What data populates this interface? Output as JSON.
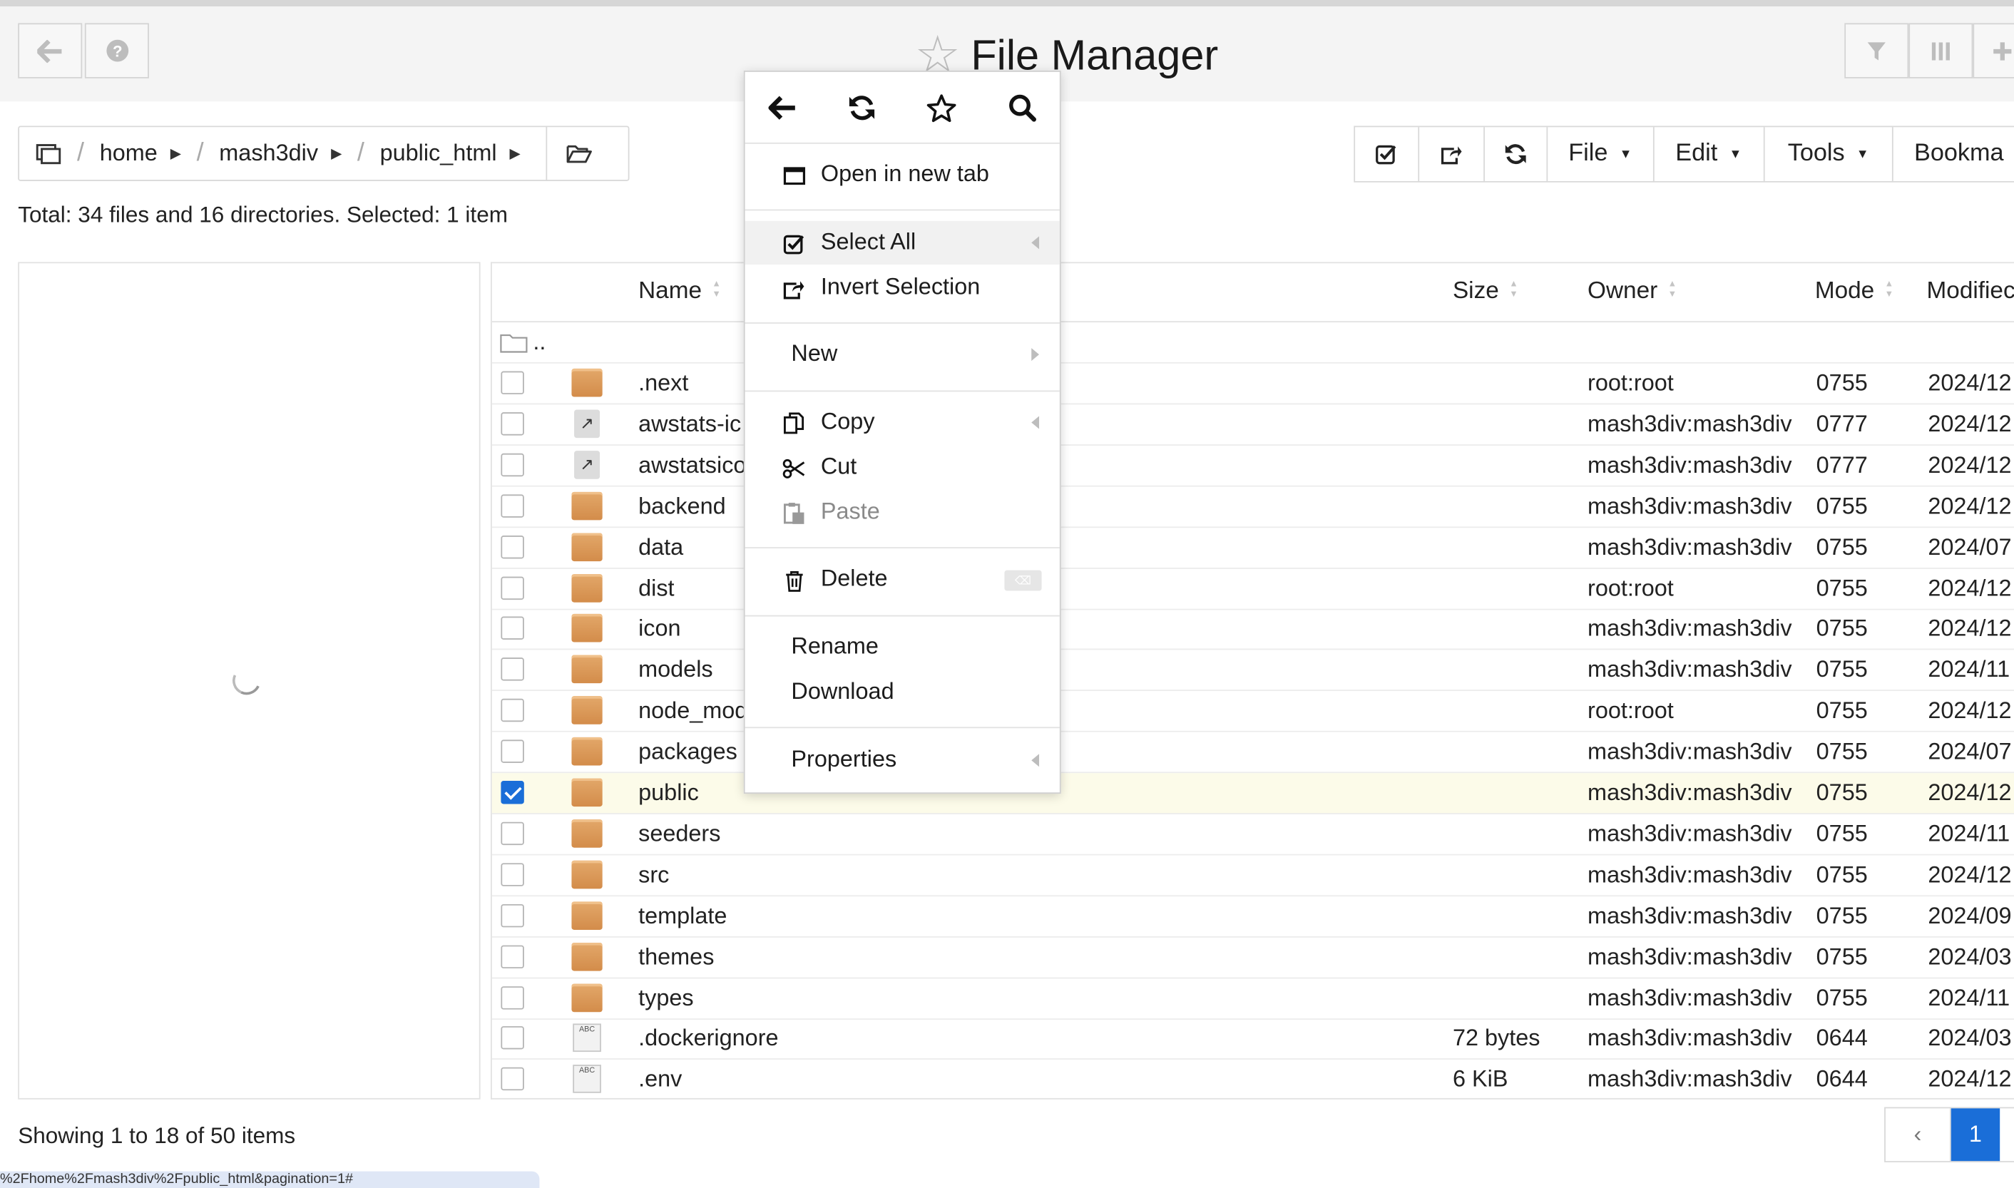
{
  "app": {
    "title": "File Manager",
    "colors": {
      "accent": "#1a6ed8",
      "folder": "#d99a5a",
      "selected_row": "#fcfbe9"
    }
  },
  "header": {
    "left_buttons": [
      {
        "icon": "arrow-left-icon"
      },
      {
        "icon": "question-circle-icon"
      }
    ],
    "right_buttons": [
      {
        "icon": "filter-icon"
      },
      {
        "icon": "columns-icon"
      },
      {
        "icon": "plus-icon"
      }
    ]
  },
  "breadcrumb": {
    "items": [
      "home",
      "mash3div",
      "public_html"
    ],
    "separator": "/"
  },
  "toolbar": {
    "icons": [
      "check-square-icon",
      "share-square-icon",
      "refresh-icon"
    ],
    "menus": [
      "File",
      "Edit",
      "Tools",
      "Bookma"
    ]
  },
  "summary": "Total: 34 files and 16 directories. Selected: 1 item",
  "table": {
    "columns": {
      "name": "Name",
      "size": "Size",
      "owner": "Owner",
      "mode": "Mode",
      "modified": "Modifiec"
    },
    "parent_row": "..",
    "rows": [
      {
        "name": ".next",
        "type": "folder",
        "size": "",
        "owner": "root:root",
        "mode": "0755",
        "modified": "2024/12",
        "checked": false
      },
      {
        "name": "awstats-ic",
        "type": "link",
        "size": "",
        "owner": "mash3div:mash3div",
        "mode": "0777",
        "modified": "2024/12",
        "checked": false
      },
      {
        "name": "awstatsico",
        "type": "link",
        "size": "",
        "owner": "mash3div:mash3div",
        "mode": "0777",
        "modified": "2024/12",
        "checked": false
      },
      {
        "name": "backend",
        "type": "folder",
        "size": "",
        "owner": "mash3div:mash3div",
        "mode": "0755",
        "modified": "2024/12",
        "checked": false
      },
      {
        "name": "data",
        "type": "folder",
        "size": "",
        "owner": "mash3div:mash3div",
        "mode": "0755",
        "modified": "2024/07",
        "checked": false
      },
      {
        "name": "dist",
        "type": "folder",
        "size": "",
        "owner": "root:root",
        "mode": "0755",
        "modified": "2024/12",
        "checked": false
      },
      {
        "name": "icon",
        "type": "folder",
        "size": "",
        "owner": "mash3div:mash3div",
        "mode": "0755",
        "modified": "2024/12",
        "checked": false
      },
      {
        "name": "models",
        "type": "folder",
        "size": "",
        "owner": "mash3div:mash3div",
        "mode": "0755",
        "modified": "2024/11",
        "checked": false
      },
      {
        "name": "node_mod",
        "type": "folder",
        "size": "",
        "owner": "root:root",
        "mode": "0755",
        "modified": "2024/12",
        "checked": false
      },
      {
        "name": "packages",
        "type": "folder",
        "size": "",
        "owner": "mash3div:mash3div",
        "mode": "0755",
        "modified": "2024/07",
        "checked": false
      },
      {
        "name": "public",
        "type": "folder",
        "size": "",
        "owner": "mash3div:mash3div",
        "mode": "0755",
        "modified": "2024/12",
        "checked": true
      },
      {
        "name": "seeders",
        "type": "folder",
        "size": "",
        "owner": "mash3div:mash3div",
        "mode": "0755",
        "modified": "2024/11",
        "checked": false
      },
      {
        "name": "src",
        "type": "folder",
        "size": "",
        "owner": "mash3div:mash3div",
        "mode": "0755",
        "modified": "2024/12",
        "checked": false
      },
      {
        "name": "template",
        "type": "folder",
        "size": "",
        "owner": "mash3div:mash3div",
        "mode": "0755",
        "modified": "2024/09",
        "checked": false
      },
      {
        "name": "themes",
        "type": "folder",
        "size": "",
        "owner": "mash3div:mash3div",
        "mode": "0755",
        "modified": "2024/03",
        "checked": false
      },
      {
        "name": "types",
        "type": "folder",
        "size": "",
        "owner": "mash3div:mash3div",
        "mode": "0755",
        "modified": "2024/11",
        "checked": false
      },
      {
        "name": ".dockerignore",
        "type": "text",
        "size": "72 bytes",
        "owner": "mash3div:mash3div",
        "mode": "0644",
        "modified": "2024/03",
        "checked": false
      },
      {
        "name": ".env",
        "type": "text",
        "size": "6 KiB",
        "owner": "mash3div:mash3div",
        "mode": "0644",
        "modified": "2024/12",
        "checked": false
      }
    ]
  },
  "footer": {
    "showing": "Showing 1 to 18 of 50 items",
    "pager_prev": "‹",
    "pager_page": "1",
    "status_url": "%2Fhome%2Fmash3div%2Fpublic_html&pagination=1#"
  },
  "context_menu": {
    "top_icons": [
      "arrow-left-icon",
      "refresh-icon",
      "star-icon",
      "search-icon"
    ],
    "items": {
      "open_new_tab": "Open in new tab",
      "select_all": "Select All",
      "invert_selection": "Invert Selection",
      "new": "New",
      "copy": "Copy",
      "cut": "Cut",
      "paste": "Paste",
      "delete": "Delete",
      "delete_key": "⌫",
      "rename": "Rename",
      "download": "Download",
      "properties": "Properties"
    }
  }
}
